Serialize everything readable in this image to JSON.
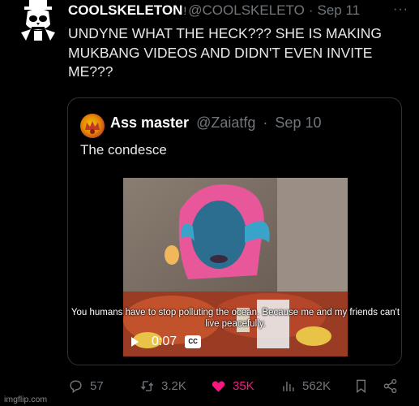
{
  "tweet": {
    "author_name": "COOLSKELETON",
    "author_badge": "!",
    "handle": "@COOLSKELETO",
    "separator": "·",
    "date": "Sep 11",
    "more": "···",
    "text": "UNDYNE WHAT THE HECK??? SHE IS MAKING\nMUKBANG VIDEOS AND DIDN'T EVEN INVITE\nME???"
  },
  "quote": {
    "author_name": "Ass master",
    "handle": "@Zaiatfg",
    "separator": "·",
    "date": "Sep 10",
    "text": "The condesce",
    "video": {
      "caption": "You humans have to stop polluting the ocean. Because me and my friends can't\nlive peacefully.",
      "time": "0:07",
      "cc_label": "CC"
    }
  },
  "actions": {
    "replies": "57",
    "reposts": "3.2K",
    "likes": "35K",
    "views": "562K"
  },
  "colors": {
    "background": "#000000",
    "muted": "#71767b",
    "like": "#f91880",
    "border": "#2f3336"
  },
  "watermark": "imgflip.com"
}
